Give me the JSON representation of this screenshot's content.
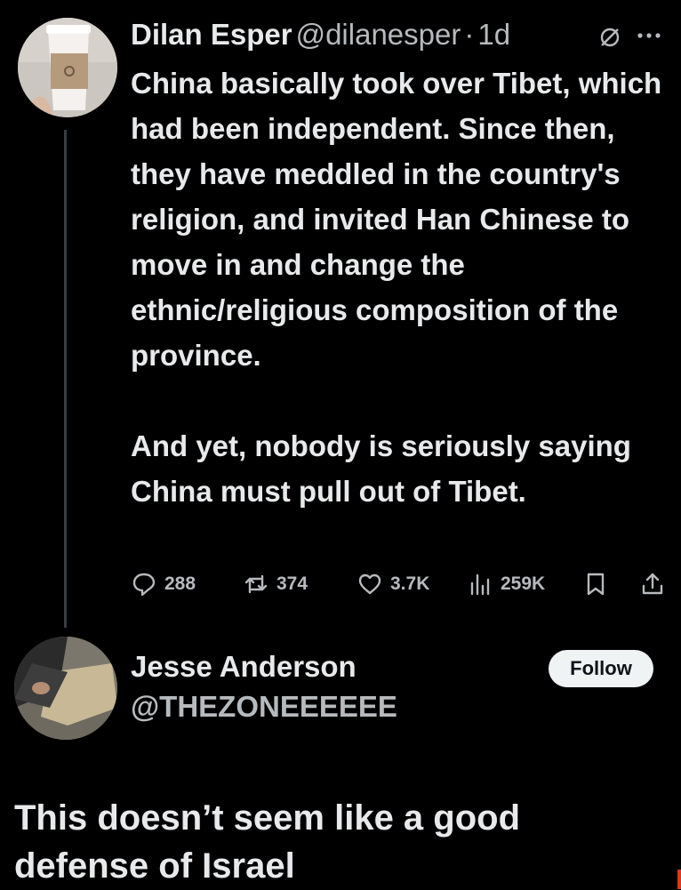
{
  "tweet": {
    "author_name": "Dilan Esper",
    "author_handle": "@dilanesper",
    "separator": "·",
    "time": "1d",
    "paragraphs": [
      "China basically took over Tibet, which had been independent. Since then, they have meddled in the country's religion, and invited Han Chinese to move in and change the ethnic/religious composition of the province.",
      "And yet, nobody is seriously saying China must pull out of Tibet."
    ],
    "stats": {
      "replies": "288",
      "retweets": "374",
      "likes": "3.7K",
      "views": "259K"
    }
  },
  "reply_author": {
    "name": "Jesse Anderson",
    "handle": "@THEZONEEEEEE",
    "follow_label": "Follow"
  },
  "reply_text": "This doesn’t seem like a good defense of Israel",
  "colors": {
    "background": "#000000",
    "text": "#e7e9ea",
    "secondary": "#b6babd",
    "follow_bg": "#eff3f4"
  }
}
